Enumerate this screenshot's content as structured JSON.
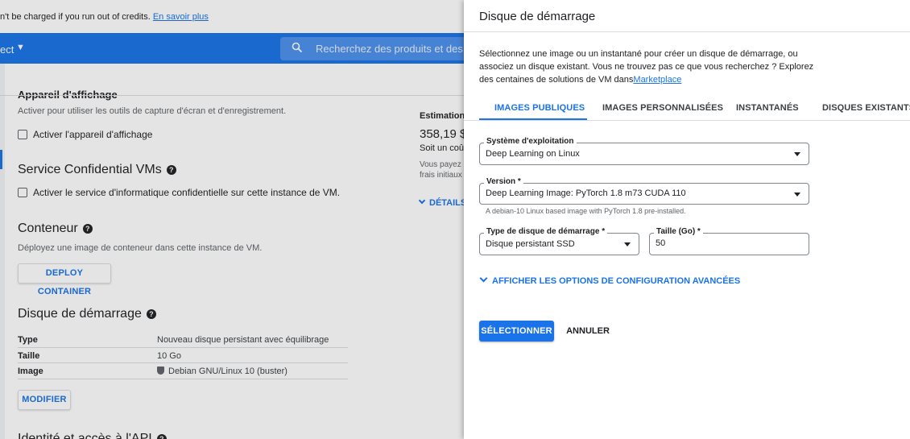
{
  "background": {
    "credit_text": "n't be charged if you run out of credits. ",
    "credit_link": "En savoir plus",
    "project_label": "ect",
    "search_placeholder": "Recherchez des produits et des re",
    "display_device": {
      "title_cut": "Appareil d'affichage",
      "desc": "Activer pour utiliser les outils de capture d'écran et d'enregistrement.",
      "checkbox": "Activer l'appareil d'affichage"
    },
    "confidential": {
      "title": "Service Confidential VMs",
      "checkbox": "Activer le service d'informatique confidentielle sur cette instance de VM."
    },
    "container": {
      "title": "Conteneur",
      "desc": "Déployez une image de conteneur dans cette instance de VM.",
      "button": "DEPLOY CONTAINER"
    },
    "boot_disk": {
      "title": "Disque de démarrage",
      "rows": [
        {
          "key": "Type",
          "value": "Nouveau disque persistant avec équilibrage"
        },
        {
          "key": "Taille",
          "value": "10 Go"
        },
        {
          "key": "Image",
          "value": "Debian GNU/Linux 10 (buster)"
        }
      ],
      "button": "MODIFIER"
    },
    "identity_title_cut": "Identité et accès à l'API",
    "estimate": {
      "head": "Estimation m",
      "price": "358,19 $",
      "sub": "Soit un coût",
      "note_line1": "Vous payez c",
      "note_line2": "frais initiaux",
      "details": "DÉTAILS"
    }
  },
  "panel": {
    "title": "Disque de démarrage",
    "desc": "Sélectionnez une image ou un instantané pour créer un disque de démarrage, ou associez un disque existant. Vous ne trouvez pas ce que vous recherchez ? Explorez des centaines de solutions de VM dans",
    "marketplace_link": "Marketplace",
    "tabs": [
      {
        "label": "IMAGES PUBLIQUES",
        "active": true
      },
      {
        "label": "IMAGES PERSONNALISÉES",
        "active": false
      },
      {
        "label": "INSTANTANÉS",
        "active": false
      },
      {
        "label": "DISQUES EXISTANTS",
        "active": false
      }
    ],
    "os": {
      "label": "Système d'exploitation",
      "value": "Deep Learning on Linux"
    },
    "version": {
      "label": "Version *",
      "value": "Deep Learning Image: PyTorch 1.8 m73 CUDA 110",
      "hint": "A debian-10 Linux based image with PyTorch 1.8 pre-installed."
    },
    "disk_type": {
      "label": "Type de disque de démarrage *",
      "value": "Disque persistant SSD"
    },
    "size": {
      "label": "Taille (Go) *",
      "value": "50"
    },
    "advanced_label": "AFFICHER LES OPTIONS DE CONFIGURATION AVANCÉES",
    "select_button": "SÉLECTIONNER",
    "cancel_button": "ANNULER",
    "colors": {
      "accent": "#1a73e8",
      "text": "#202124",
      "border": "#80868b"
    }
  }
}
